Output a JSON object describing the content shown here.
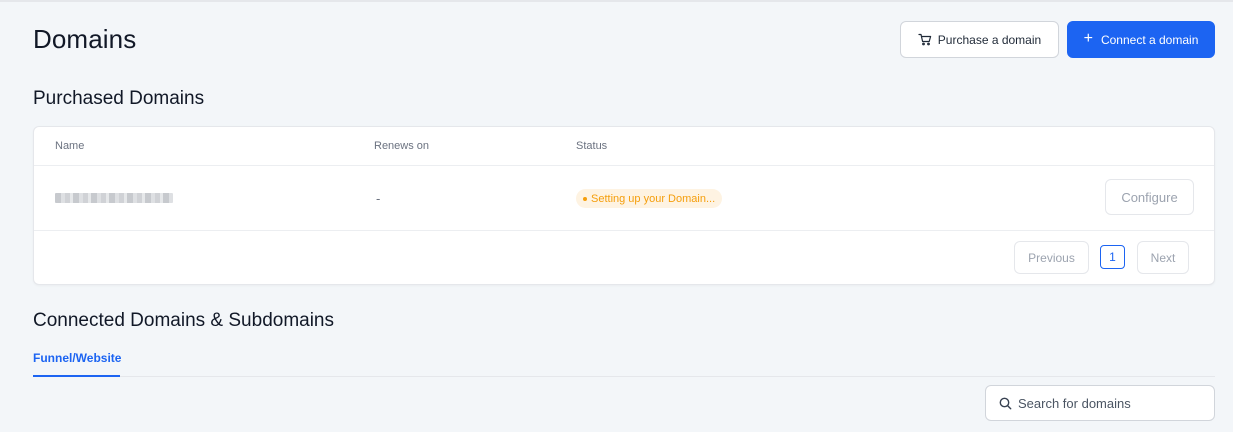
{
  "header": {
    "title": "Domains",
    "purchase_button": {
      "label": "Purchase a domain",
      "icon": "cart-icon"
    },
    "connect_button": {
      "label": "Connect a domain",
      "icon": "plus-icon",
      "plus": "+"
    }
  },
  "purchased": {
    "title": "Purchased Domains",
    "columns": [
      "Name",
      "Renews on",
      "Status"
    ],
    "rows": [
      {
        "name": "",
        "renews_on": "-",
        "status": "Setting up your Domain...",
        "action": "Configure"
      }
    ],
    "pagination": {
      "previous": "Previous",
      "current_page": "1",
      "next": "Next"
    }
  },
  "connected": {
    "title": "Connected Domains & Subdomains",
    "tabs": [
      {
        "label": "Funnel/Website",
        "active": true
      }
    ],
    "search": {
      "placeholder": "Search for domains"
    }
  },
  "colors": {
    "accent": "#1c64f2",
    "status_warning": "#f59e0b",
    "status_warning_bg": "#fef3e2"
  }
}
